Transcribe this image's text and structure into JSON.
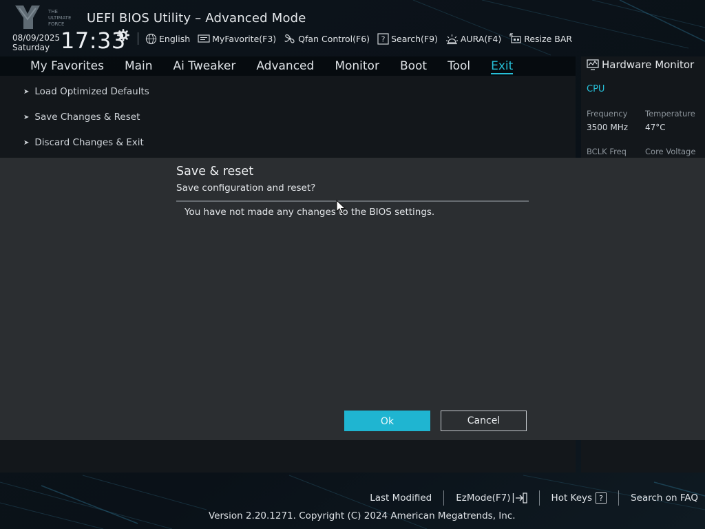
{
  "header": {
    "title": "UEFI BIOS Utility – Advanced Mode",
    "logo_text": "THE ULTIMATE FORCE",
    "date": "08/09/2025",
    "day": "Saturday",
    "time": "17:33",
    "menu": [
      {
        "label": "English",
        "icon": "globe-icon"
      },
      {
        "label": "MyFavorite(F3)",
        "icon": "favorite-icon"
      },
      {
        "label": "Qfan Control(F6)",
        "icon": "fan-icon"
      },
      {
        "label": "Search(F9)",
        "icon": "question-icon"
      },
      {
        "label": "AURA(F4)",
        "icon": "aura-icon"
      },
      {
        "label": "Resize BAR",
        "icon": "resize-bar-icon"
      }
    ]
  },
  "nav": {
    "tabs": [
      "My Favorites",
      "Main",
      "Ai Tweaker",
      "Advanced",
      "Monitor",
      "Boot",
      "Tool",
      "Exit"
    ],
    "active": "Exit"
  },
  "main": {
    "items": [
      "Load Optimized Defaults",
      "Save Changes & Reset",
      "Discard Changes & Exit"
    ]
  },
  "hardware_monitor": {
    "title": "Hardware Monitor",
    "section": "CPU",
    "frequency_label": "Frequency",
    "frequency_value": "3500 MHz",
    "temperature_label": "Temperature",
    "temperature_value": "47°C",
    "bclk_label": "BCLK Freq",
    "voltage_label": "Core Voltage"
  },
  "dialog": {
    "title": "Save & reset",
    "subtitle": "Save configuration and reset?",
    "message": "You have not made any changes to the BIOS settings.",
    "ok_label": "Ok",
    "cancel_label": "Cancel"
  },
  "footer": {
    "last_modified": "Last Modified",
    "ezmode": "EzMode(F7)",
    "hotkeys": "Hot Keys",
    "hotkeys_key": "?",
    "faq": "Search on FAQ",
    "copyright": "Version 2.20.1271. Copyright (C) 2024 American Megatrends, Inc."
  },
  "colors": {
    "accent": "#27c0d8",
    "ok_button": "#1fb5d1",
    "dialog_bg": "#2b2e31",
    "panel_bg": "#13171b"
  }
}
